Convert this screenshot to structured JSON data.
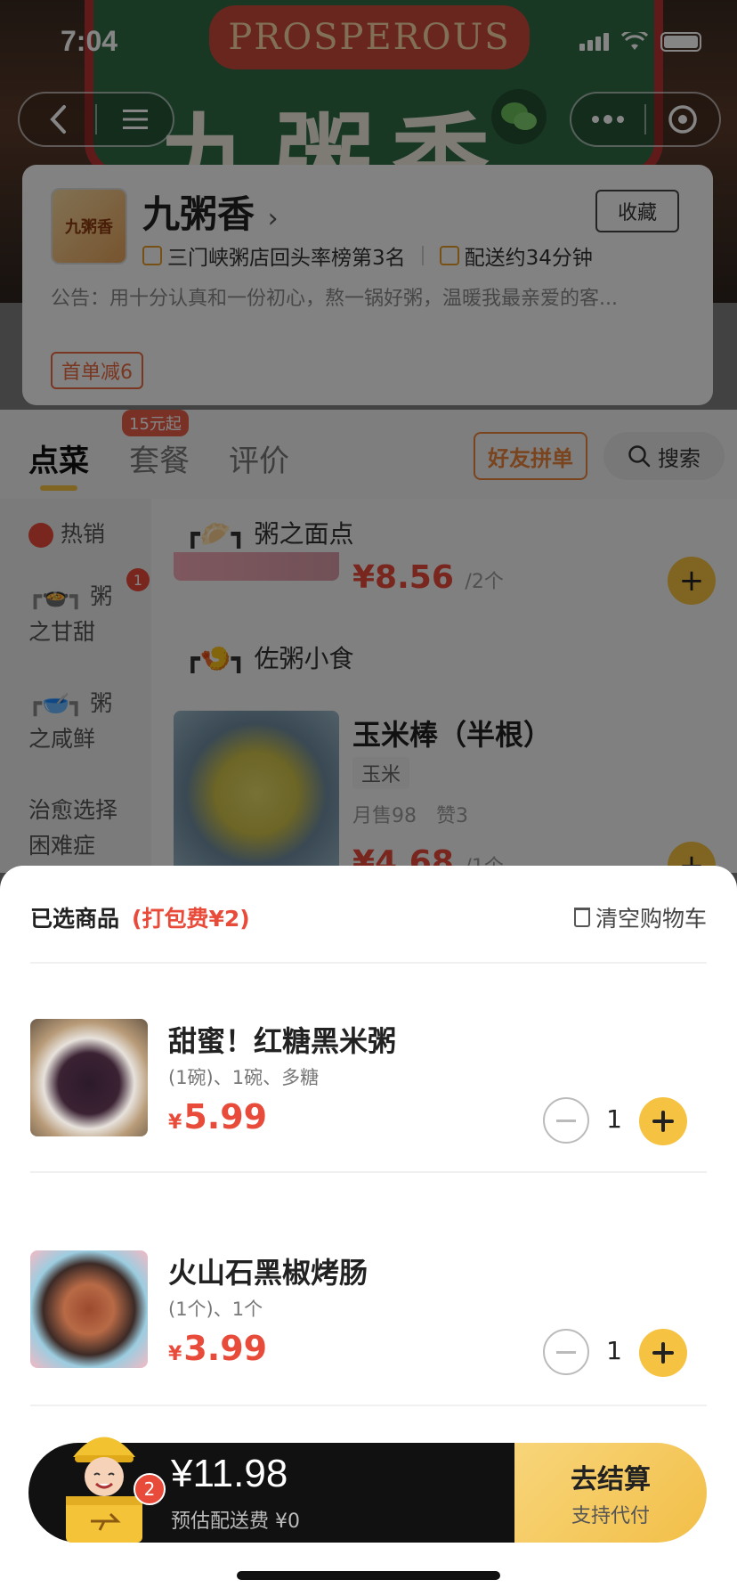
{
  "status_bar": {
    "time": "7:04"
  },
  "hero": {
    "banner": "PROSPEROUS",
    "sign_text": "九粥香"
  },
  "shop": {
    "logo_text": "九粥香",
    "name": "九粥香",
    "name_arrow": "›",
    "favorite_label": "收藏",
    "rank_text": "三门峡粥店回头率榜第3名",
    "delivery_text": "配送约34分钟",
    "notice": "公告：用十分认真和一份初心，熬一锅好粥，温暖我最亲爱的客...",
    "coupon": "首单减6"
  },
  "tabs": {
    "items": [
      {
        "label": "点菜"
      },
      {
        "label": "套餐"
      },
      {
        "label": "评价"
      }
    ],
    "badge": "15元起",
    "group_order": "好友拼单",
    "search": "搜索"
  },
  "sidebar": {
    "items": [
      {
        "label": "热销"
      },
      {
        "label": "粥",
        "label2": "之甘甜"
      },
      {
        "label": "粥",
        "label2": "之咸鲜"
      },
      {
        "label": "治愈选择",
        "label2": "困难症"
      }
    ],
    "badge": "1"
  },
  "menu": {
    "section1": "粥之面点",
    "price1": "¥8.56",
    "unit1": "/2个",
    "section2": "佐粥小食",
    "dish_name": "玉米棒（半根）",
    "dish_tag": "玉米",
    "dish_stats": "月售98　赞3",
    "price2": "¥4.68",
    "unit2": "/1个"
  },
  "cart": {
    "title": "已选商品",
    "packing_fee": "(打包费¥2)",
    "clear_label": "清空购物车",
    "items": [
      {
        "name": "甜蜜！红糖黑米粥",
        "spec": "(1碗)、1碗、多糖",
        "currency": "¥",
        "price": "5.99",
        "qty": "1"
      },
      {
        "name": "火山石黑椒烤肠",
        "spec": "(1个)、1个",
        "currency": "¥",
        "price": "3.99",
        "qty": "1"
      }
    ]
  },
  "checkout": {
    "badge": "2",
    "total": "¥11.98",
    "delivery_fee": "预估配送费 ¥0",
    "button": "去结算",
    "button_sub": "支持代付"
  },
  "colors": {
    "accent": "#f5c242",
    "price": "#e84b3a",
    "brand_orange": "#e8823a"
  }
}
